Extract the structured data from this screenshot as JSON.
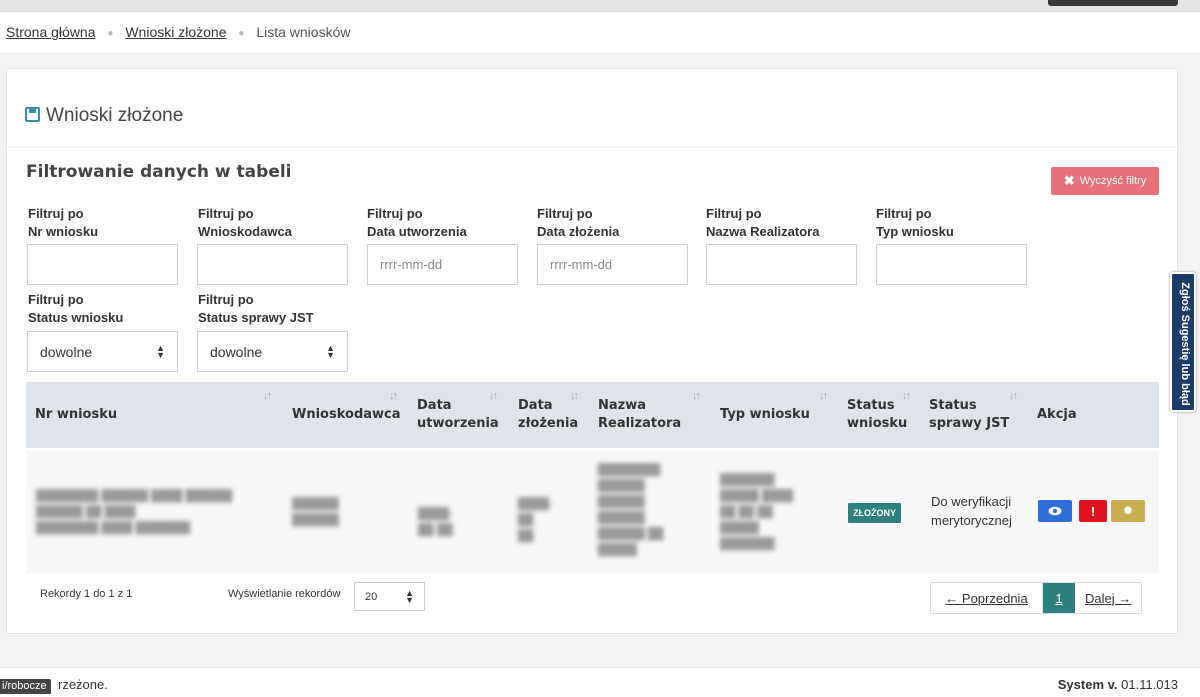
{
  "breadcrumb": {
    "home": "Strona główna",
    "submitted": "Wnioski złożone",
    "current": "Lista wniosków"
  },
  "panel": {
    "title": "Wnioski złożone"
  },
  "filters": {
    "title": "Filtrowanie danych w tabeli",
    "clear_label": "Wyczyść filtry",
    "prefix": "Filtruj po",
    "nr": "Nr wniosku",
    "applicant": "Wnioskodawca",
    "created": "Data utworzenia",
    "submitted": "Data złożenia",
    "realizer": "Nazwa Realizatora",
    "type": "Typ wniosku",
    "status": "Status wniosku",
    "status_jst": "Status sprawy JST",
    "date_placeholder": "rrrr-mm-dd",
    "any": "dowolne"
  },
  "table": {
    "col_nr": "Nr wniosku",
    "col_applicant": "Wnioskodawca",
    "col_created_1": "Data",
    "col_created_2": "utworzenia",
    "col_submitted_1": "Data",
    "col_submitted_2": "złożenia",
    "col_realizer_1": "Nazwa",
    "col_realizer_2": "Realizatora",
    "col_type": "Typ wniosku",
    "col_status_1": "Status",
    "col_status_2": "wniosku",
    "col_jst_1": "Status",
    "col_jst_2": "sprawy JST",
    "col_action": "Akcja",
    "row": {
      "status": "ZŁOŻONY",
      "status_jst_1": "Do weryfikacji",
      "status_jst_2": "merytorycznej"
    }
  },
  "records_info": "Rekordy 1 do 1 z 1",
  "per_page_label": "Wyświetlanie rekordów",
  "per_page_value": "20",
  "pagination": {
    "prev": "← Poprzednia",
    "page": "1",
    "next": "Dalej →"
  },
  "side_tab": "Zgłoś Sugestię lub błąd",
  "footer": {
    "tag": "i/robocze",
    "left": "rzeżone.",
    "version_label": "System v.",
    "version": "01.11.013"
  },
  "colors": {
    "teal": "#2e7f80",
    "danger_light": "#e8707a",
    "view": "#2f6fdc",
    "report": "#e0141c",
    "config": "#c9ad4e"
  }
}
